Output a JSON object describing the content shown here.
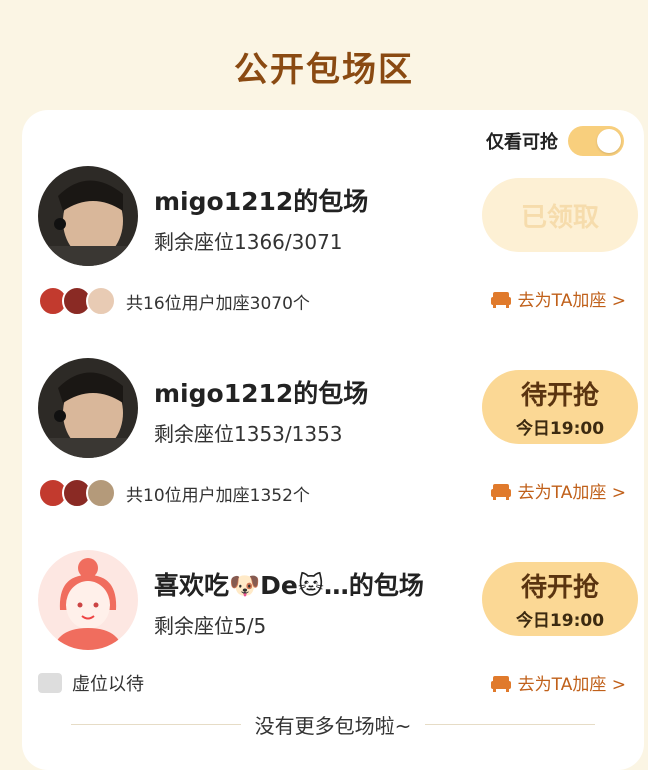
{
  "header": {
    "title": "公开包场区"
  },
  "filter": {
    "label": "仅看可抢",
    "enabled": true
  },
  "sessions": [
    {
      "name": "migo1212的包场",
      "seats": "剩余座位1366/3071",
      "button_main": "已领取",
      "button_sub": "",
      "button_state": "disabled",
      "users_text": "共16位用户加座3070个",
      "join_label": "去为TA加座 >"
    },
    {
      "name": "migo1212的包场",
      "seats": "剩余座位1353/1353",
      "button_main": "待开抢",
      "button_sub": "今日19:00",
      "button_state": "active",
      "users_text": "共10位用户加座1352个",
      "join_label": "去为TA加座 >"
    },
    {
      "name": "喜欢吃🐶De🐱…的包场",
      "seats": "剩余座位5/5",
      "button_main": "待开抢",
      "button_sub": "今日19:00",
      "button_state": "active",
      "waiting_text": "虚位以待",
      "join_label": "去为TA加座 >"
    }
  ],
  "footer": {
    "text": "没有更多包场啦~"
  },
  "colors": {
    "accent": "#fbd895",
    "brand_title": "#8a4a12",
    "link": "#c0601a",
    "background": "#fbf5e4"
  }
}
